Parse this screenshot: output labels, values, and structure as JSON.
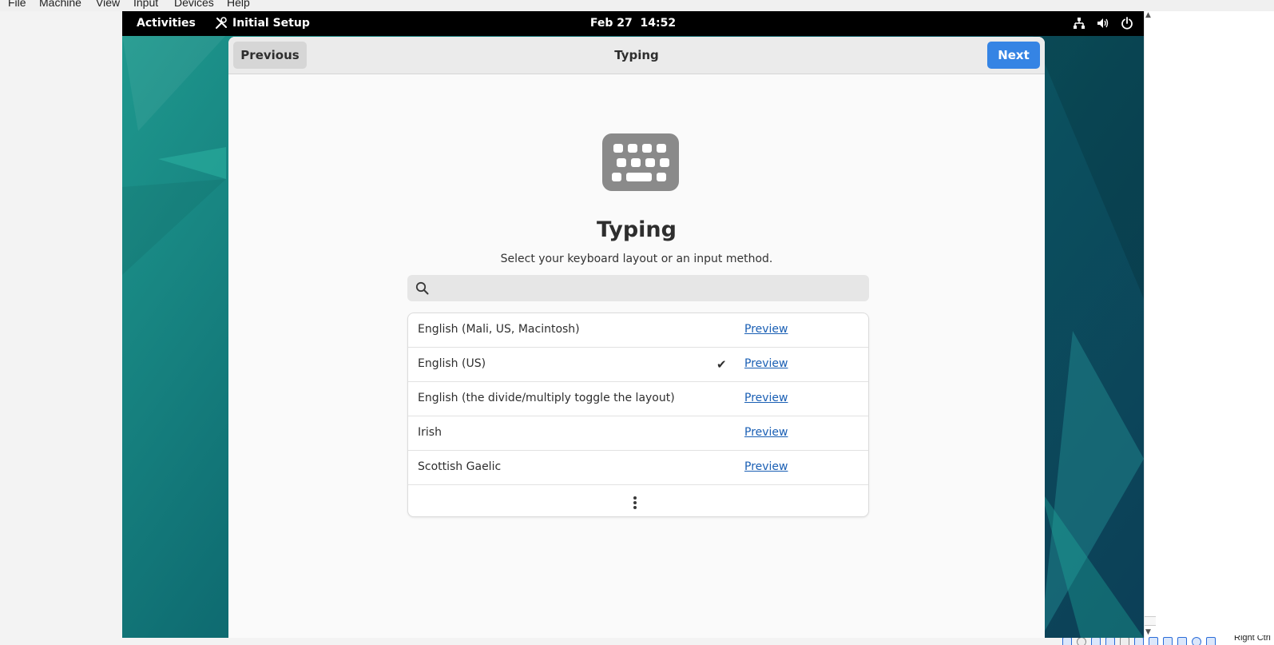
{
  "host": {
    "menu": [
      "File",
      "Machine",
      "View",
      "Input",
      "Devices",
      "Help"
    ],
    "status_text": "Right Ctrl"
  },
  "topbar": {
    "activities": "Activities",
    "app_name": "Initial Setup",
    "date": "Feb 27",
    "time": "14:52",
    "tray_icons": [
      "network-icon",
      "volume-icon",
      "power-icon"
    ]
  },
  "header": {
    "previous": "Previous",
    "title": "Typing",
    "next": "Next"
  },
  "page": {
    "title": "Typing",
    "subtitle": "Select your keyboard layout or an input method.",
    "search_value": ""
  },
  "layouts": [
    {
      "name": "English (Mali, US, Macintosh)",
      "selected": false,
      "preview": "Preview"
    },
    {
      "name": "English (US)",
      "selected": true,
      "preview": "Preview"
    },
    {
      "name": "English (the divide/multiply toggle the layout)",
      "selected": false,
      "preview": "Preview"
    },
    {
      "name": "Irish",
      "selected": false,
      "preview": "Preview"
    },
    {
      "name": "Scottish Gaelic",
      "selected": false,
      "preview": "Preview"
    }
  ],
  "colors": {
    "accent": "#3584e4",
    "link": "#1a5fb4",
    "topbar": "#000000"
  }
}
